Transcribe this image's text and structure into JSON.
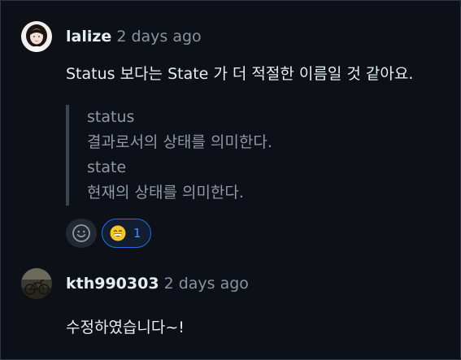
{
  "comments": [
    {
      "author": "lalize",
      "time": "2 days ago",
      "text": "Status 보다는 State 가 더 적절한 이름일 것 같아요.",
      "quote": [
        "status",
        "결과로서의 상태를 의미한다.",
        "state",
        "현재의 상태를 의미한다."
      ],
      "reactions": {
        "add_icon": "smiley-add-icon",
        "items": [
          {
            "emoji": "grinning-face-icon",
            "count": "1"
          }
        ]
      }
    },
    {
      "author": "kth990303",
      "time": "2 days ago",
      "text": "수정하였습니다~!"
    }
  ],
  "colors": {
    "background": "#0d1117",
    "text": "#e6edf3",
    "muted": "#8b949e",
    "quote_text": "#9198a1",
    "accent": "#1f6feb",
    "accent_text": "#4493f8"
  }
}
